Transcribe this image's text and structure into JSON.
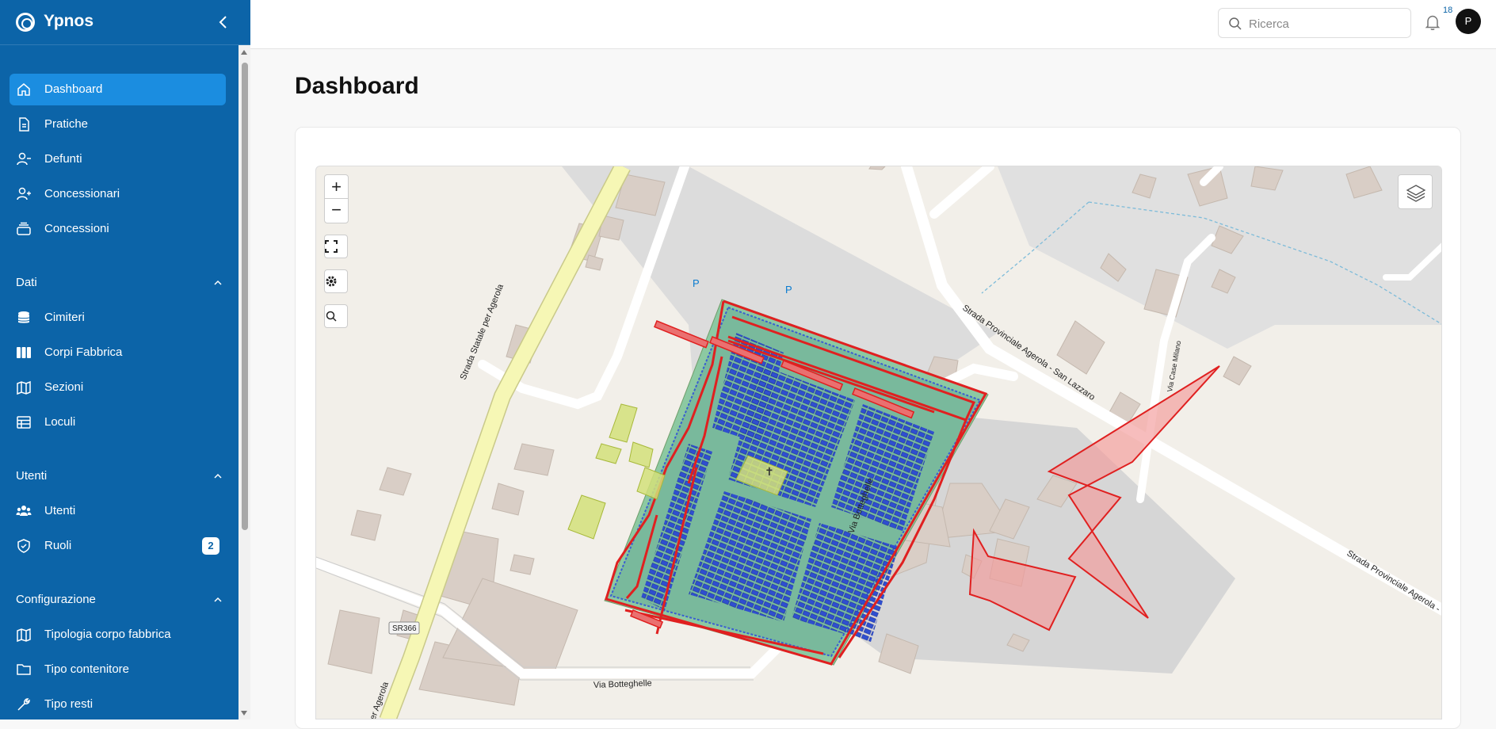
{
  "app": {
    "name": "Ypnos"
  },
  "sidebar": {
    "main_items": [
      {
        "label": "Dashboard",
        "icon": "home-icon",
        "active": true
      },
      {
        "label": "Pratiche",
        "icon": "document-icon"
      },
      {
        "label": "Defunti",
        "icon": "user-minus-icon"
      },
      {
        "label": "Concessionari",
        "icon": "user-plus-icon"
      },
      {
        "label": "Concessioni",
        "icon": "stack-icon"
      }
    ],
    "sections": [
      {
        "title": "Dati",
        "items": [
          {
            "label": "Cimiteri",
            "icon": "database-icon"
          },
          {
            "label": "Corpi Fabbrica",
            "icon": "columns-icon"
          },
          {
            "label": "Sezioni",
            "icon": "map-icon"
          },
          {
            "label": "Loculi",
            "icon": "table-icon"
          }
        ]
      },
      {
        "title": "Utenti",
        "items": [
          {
            "label": "Utenti",
            "icon": "users-icon"
          },
          {
            "label": "Ruoli",
            "icon": "shield-icon",
            "badge": "2"
          }
        ]
      },
      {
        "title": "Configurazione",
        "items": [
          {
            "label": "Tipologia corpo fabbrica",
            "icon": "map-icon"
          },
          {
            "label": "Tipo contenitore",
            "icon": "folder-icon"
          },
          {
            "label": "Tipo resti",
            "icon": "wrench-icon"
          }
        ]
      }
    ]
  },
  "topbar": {
    "search_placeholder": "Ricerca",
    "notification_count": "18",
    "avatar_initial": "P"
  },
  "main": {
    "title": "Dashboard"
  },
  "map": {
    "controls": {
      "zoom_in": "+",
      "zoom_out": "−"
    },
    "road_labels": {
      "strada_statale": "Strada Statale per Agerola",
      "strada_provinciale": "Strada Provinciale Agerola - San Lazzaro",
      "strada_provinciale_2": "Strada Provinciale Agerola -",
      "via_botteghelle": "Via Botteghelle",
      "via_botteghelle_2": "Via Botteghelle",
      "via_case_milano": "Via Case Milano",
      "sr366": "SR366",
      "per_agerola": "per Agerola"
    },
    "parking_labels": [
      "P",
      "P"
    ]
  }
}
